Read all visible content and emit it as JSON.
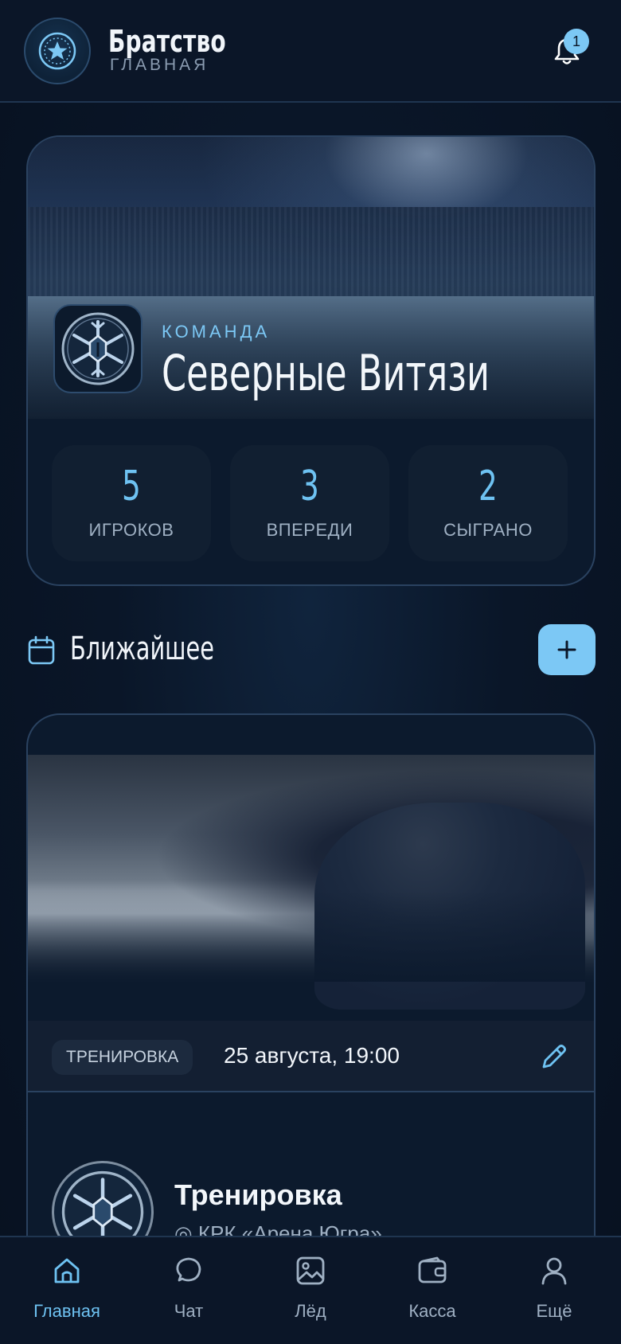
{
  "header": {
    "title": "Братство",
    "subtitle": "ГЛАВНАЯ",
    "notification_count": "1"
  },
  "team": {
    "label": "КОМАНДА",
    "name": "Северные Витязи",
    "stats": [
      {
        "value": "5",
        "label": "ИГРОКОВ"
      },
      {
        "value": "3",
        "label": "ВПЕРЕДИ"
      },
      {
        "value": "2",
        "label": "СЫГРАНО"
      }
    ]
  },
  "upcoming": {
    "title": "Ближайшее",
    "add_label": "+"
  },
  "event": {
    "type": "ТРЕНИРОВКА",
    "date": "25 августа, 19:00",
    "title": "Тренировка",
    "location": "КРК «Арена Югра»"
  },
  "nav": [
    {
      "label": "Главная",
      "icon": "home-icon",
      "active": true
    },
    {
      "label": "Чат",
      "icon": "chat-icon"
    },
    {
      "label": "Лёд",
      "icon": "image-icon"
    },
    {
      "label": "Касса",
      "icon": "wallet-icon"
    },
    {
      "label": "Ещё",
      "icon": "profile-icon"
    }
  ],
  "colors": {
    "accent": "#7cc8f5",
    "background": "#0a1628",
    "card": "#0c1a2d"
  }
}
